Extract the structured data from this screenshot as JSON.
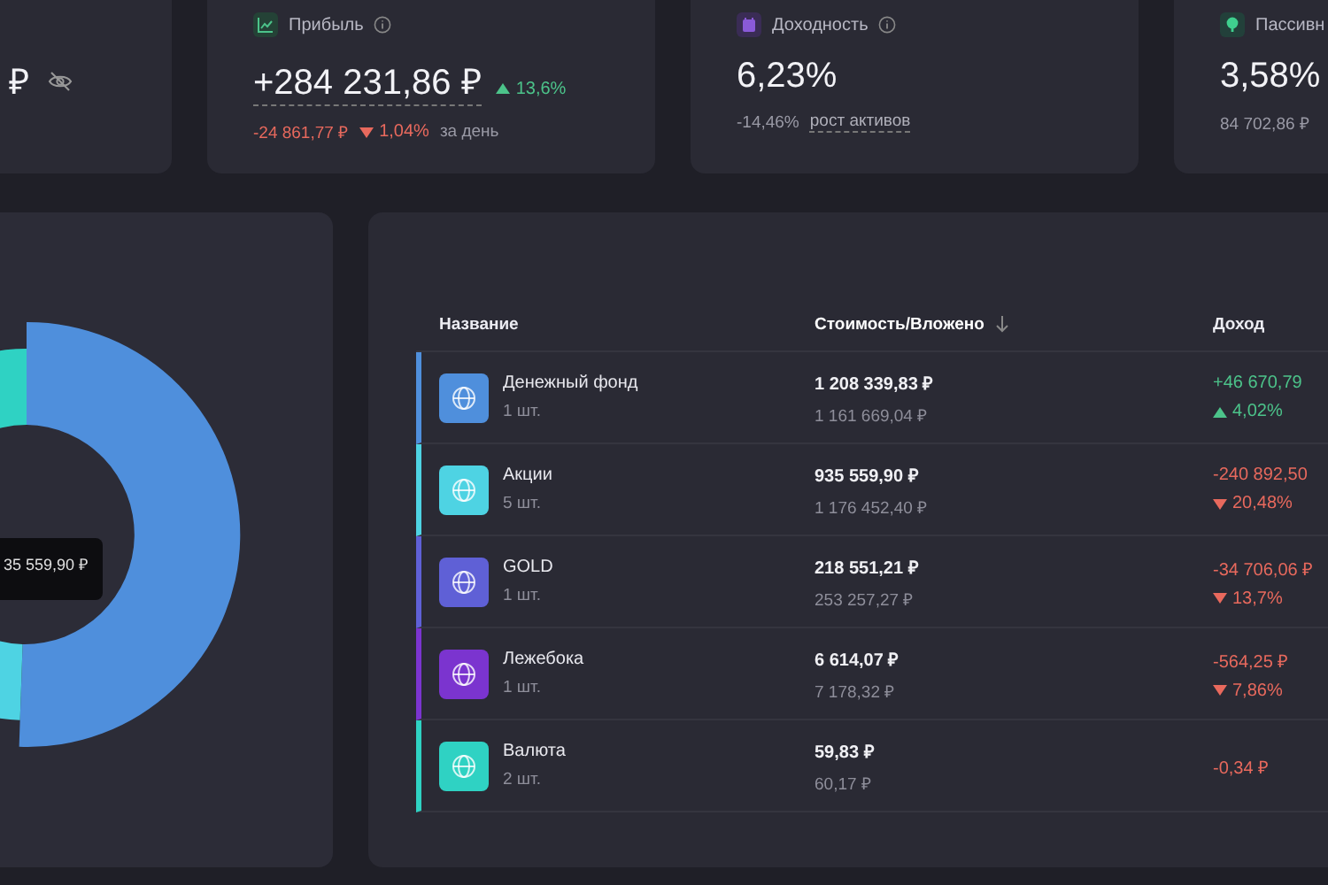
{
  "cards": [
    {
      "kind": "hidden",
      "value": "₽"
    },
    {
      "kind": "profit",
      "label": "Прибыль",
      "info": true,
      "value": "+284 231,86 ₽",
      "change": "13,6%",
      "change_up": true,
      "sub_amount": "-24 861,77 ₽",
      "sub_change": "1,04%",
      "sub_up": false,
      "sub_note": "за день"
    },
    {
      "kind": "yield",
      "label": "Доходность",
      "info": true,
      "value": "6,23%",
      "sub_amount": "-14,46%",
      "sub_note": "рост активов"
    },
    {
      "kind": "passive",
      "label": "Пассивн",
      "info": false,
      "value": "3,58%",
      "sub_amount": "84 702,86 ₽"
    }
  ],
  "chart": {
    "tooltip": "35 559,90 ₽"
  },
  "table": {
    "columns": [
      {
        "label": "Название",
        "sorted": false
      },
      {
        "label": "Стоимость/Вложено",
        "sorted": true
      },
      {
        "label": "Доход",
        "sorted": false
      }
    ],
    "rows": [
      {
        "color": "#4f8fdc",
        "name": "Денежный фонд",
        "qty": "1 шт.",
        "value": "1 208 339,83 ₽",
        "invested": "1 161 669,04 ₽",
        "income": "+46 670,79",
        "percent": "4,02%",
        "gain": true
      },
      {
        "color": "#4ed3e3",
        "name": "Акции",
        "qty": "5 шт.",
        "value": "935 559,90 ₽",
        "invested": "1 176 452,40 ₽",
        "income": "-240 892,50",
        "percent": "20,48%",
        "gain": false
      },
      {
        "color": "#5f60d6",
        "name": "GOLD",
        "qty": "1 шт.",
        "value": "218 551,21 ₽",
        "invested": "253 257,27 ₽",
        "income": "-34 706,06 ₽",
        "percent": "13,7%",
        "gain": false
      },
      {
        "color": "#7b34cf",
        "name": "Лежебока",
        "qty": "1 шт.",
        "value": "6 614,07 ₽",
        "invested": "7 178,32 ₽",
        "income": "-564,25 ₽",
        "percent": "7,86%",
        "gain": false
      },
      {
        "color": "#2fd2c3",
        "name": "Валюта",
        "qty": "2 шт.",
        "value": "59,83 ₽",
        "invested": "60,17 ₽",
        "income": "-0,34 ₽",
        "gain": false
      }
    ]
  }
}
